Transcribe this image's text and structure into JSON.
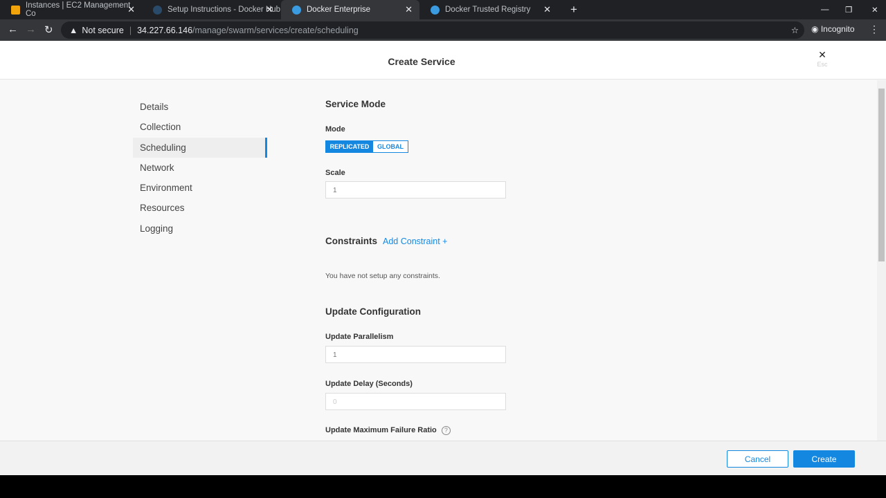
{
  "browser": {
    "tabs": [
      {
        "title": "Instances | EC2 Management Co",
        "color": "#f0a30a"
      },
      {
        "title": "Setup Instructions - Docker Hub",
        "color": "#2a4a6a"
      },
      {
        "title": "Docker Enterprise",
        "color": "#3a9be0"
      },
      {
        "title": "Docker Trusted Registry",
        "color": "#3a9be0"
      }
    ],
    "security": "Not secure",
    "url_host": "34.227.66.146",
    "url_path": "/manage/swarm/services/create/scheduling",
    "profile": "Incognito"
  },
  "header": {
    "title": "Create Service",
    "close_hint": "Esc"
  },
  "sidebar": {
    "items": [
      {
        "label": "Details"
      },
      {
        "label": "Collection"
      },
      {
        "label": "Scheduling"
      },
      {
        "label": "Network"
      },
      {
        "label": "Environment"
      },
      {
        "label": "Resources"
      },
      {
        "label": "Logging"
      }
    ]
  },
  "service_mode": {
    "heading": "Service Mode",
    "mode_label": "Mode",
    "modes": [
      "REPLICATED",
      "GLOBAL"
    ],
    "selected": "REPLICATED",
    "scale_label": "Scale",
    "scale_value": "1"
  },
  "constraints": {
    "heading": "Constraints",
    "add_label": "Add Constraint +",
    "empty": "You have not setup any constraints."
  },
  "update": {
    "heading": "Update Configuration",
    "parallelism_label": "Update Parallelism",
    "parallelism_value": "1",
    "delay_label": "Update Delay (Seconds)",
    "delay_placeholder": "0",
    "failure_label": "Update Maximum Failure Ratio"
  },
  "footer": {
    "cancel": "Cancel",
    "create": "Create"
  },
  "colors": {
    "accent": "#1488e0"
  }
}
